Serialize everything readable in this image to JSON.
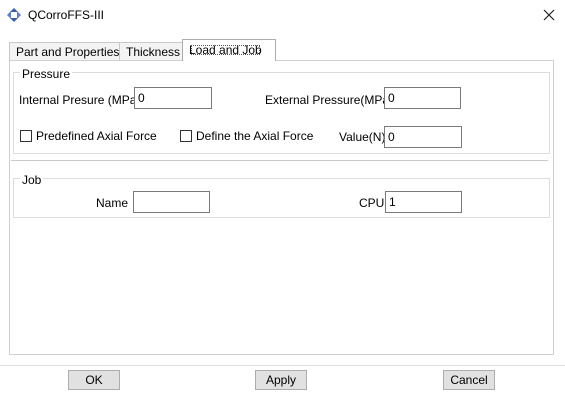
{
  "window": {
    "title": "QCorroFFS-III",
    "app_icon": "diamond-arrows-icon",
    "close_icon": "close-icon"
  },
  "tabs": [
    {
      "label": "Part and Properties",
      "active": false
    },
    {
      "label": "Thickness",
      "active": false
    },
    {
      "label": "Load and Job",
      "active": true
    }
  ],
  "pressure": {
    "group_title": "Pressure",
    "internal_label": "Internal Presure (MPa)",
    "internal_value": "0",
    "external_label": "External Pressure(MPa)",
    "external_value": "0",
    "predefined_label": "Predefined Axial Force",
    "predefined_checked": false,
    "define_label": "Define the Axial Force",
    "define_checked": false,
    "value_label": "Value(N)",
    "value_value": "0"
  },
  "job": {
    "group_title": "Job",
    "name_label": "Name",
    "name_value": "",
    "cpu_label": "CPU",
    "cpu_value": "1"
  },
  "buttons": {
    "ok": "OK",
    "apply": "Apply",
    "cancel": "Cancel"
  },
  "colors": {
    "window_bg": "#ffffff",
    "button_bg": "#e1e1e1",
    "icon_blue": "#3b5fa8"
  }
}
